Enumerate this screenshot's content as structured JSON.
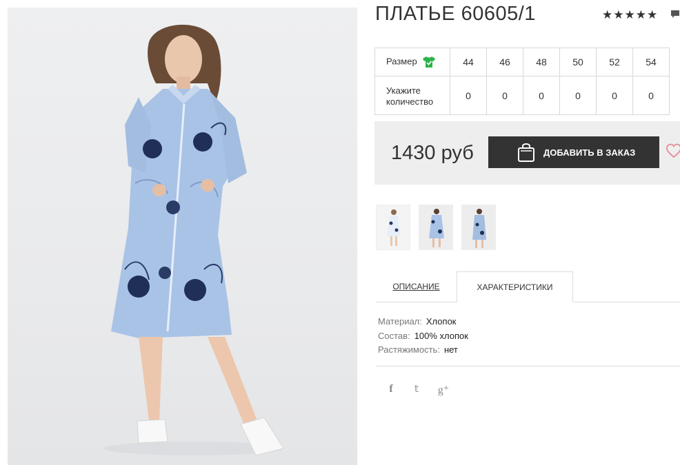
{
  "product": {
    "title": "ПЛАТЬЕ 60605/1",
    "rating_stars": "★★★★★",
    "rating_value": 5,
    "price": "1430 руб",
    "add_button_label": "ДОБАВИТЬ В ЗАКАЗ"
  },
  "sizes": {
    "size_label": "Размер",
    "qty_label": "Укажите количество",
    "values": [
      "44",
      "46",
      "48",
      "50",
      "52",
      "54"
    ],
    "quantities": [
      "0",
      "0",
      "0",
      "0",
      "0",
      "0"
    ]
  },
  "tabs": [
    {
      "label": "ОПИСАНИЕ"
    },
    {
      "label": "ХАРАКТЕРИСТИКИ"
    }
  ],
  "specs": [
    {
      "key": "Материал:",
      "value": "Хлопок"
    },
    {
      "key": "Состав:",
      "value": "100% хлопок"
    },
    {
      "key": "Растяжимость:",
      "value": "нет"
    }
  ],
  "icons": {
    "shirt_color": "#2cb34a",
    "heart_color": "#e58a9a",
    "button_bg": "#333333",
    "price_bg": "#eeeeee",
    "social": [
      "facebook-icon",
      "twitter-icon",
      "google-plus-icon"
    ],
    "social_glyphs": [
      "f",
      "𝕥",
      "g⁺"
    ]
  },
  "photo_colors": {
    "dress": "#a9c3e6",
    "embroidery": "#1f2f56",
    "background": "#eceded"
  }
}
